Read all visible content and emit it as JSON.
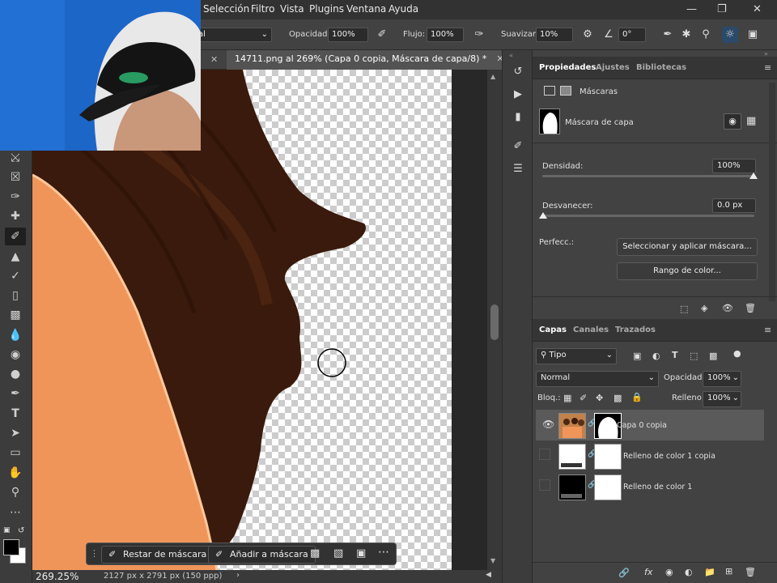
{
  "menubar": {
    "items": [
      "Selección",
      "Filtro",
      "Vista",
      "Plugins",
      "Ventana",
      "Ayuda"
    ]
  },
  "options": {
    "mode_value": "al",
    "opacity_label": "Opacidad:",
    "opacity_value": "100%",
    "flow_label": "Flujo:",
    "flow_value": "100%",
    "smooth_label": "Suavizar:",
    "smooth_value": "10%",
    "angle_value": "0°"
  },
  "document": {
    "tab_title": "14711.png al 269% (Capa 0 copia, Máscara de capa/8) *",
    "zoom": "269.25%",
    "dimensions": "2127 px x 2791 px (150 ppp)"
  },
  "context_bar": {
    "subtract_label": "Restar de máscara",
    "add_label": "Añadir a máscara"
  },
  "properties": {
    "tabs": [
      "Propiedades",
      "Ajustes",
      "Bibliotecas"
    ],
    "section_title": "Máscaras",
    "mask_label": "Máscara de capa",
    "density_label": "Densidad:",
    "density_value": "100%",
    "feather_label": "Desvanecer:",
    "feather_value": "0.0 px",
    "refine_label": "Perfecc.:",
    "select_mask_button": "Seleccionar y aplicar máscara...",
    "color_range_button": "Rango de color..."
  },
  "layers_panel": {
    "tabs": [
      "Capas",
      "Canales",
      "Trazados"
    ],
    "filter_label": "Tipo",
    "blend_mode": "Normal",
    "opacity_label": "Opacidad:",
    "opacity_value": "100%",
    "lock_label": "Bloq.:",
    "fill_label": "Relleno:",
    "fill_value": "100%",
    "layers": [
      {
        "name": "Capa 0 copia",
        "visible": true,
        "selected": true
      },
      {
        "name": "Relleno de color 1 copia",
        "visible": false,
        "selected": false
      },
      {
        "name": "Relleno de color 1",
        "visible": false,
        "selected": false
      }
    ]
  },
  "colors": {
    "panel_bg": "#424242",
    "menubar_bg": "#323232",
    "hair": "#3a1a0c",
    "skin": "#f0955a",
    "selected_layer": "#5a5a5a"
  }
}
